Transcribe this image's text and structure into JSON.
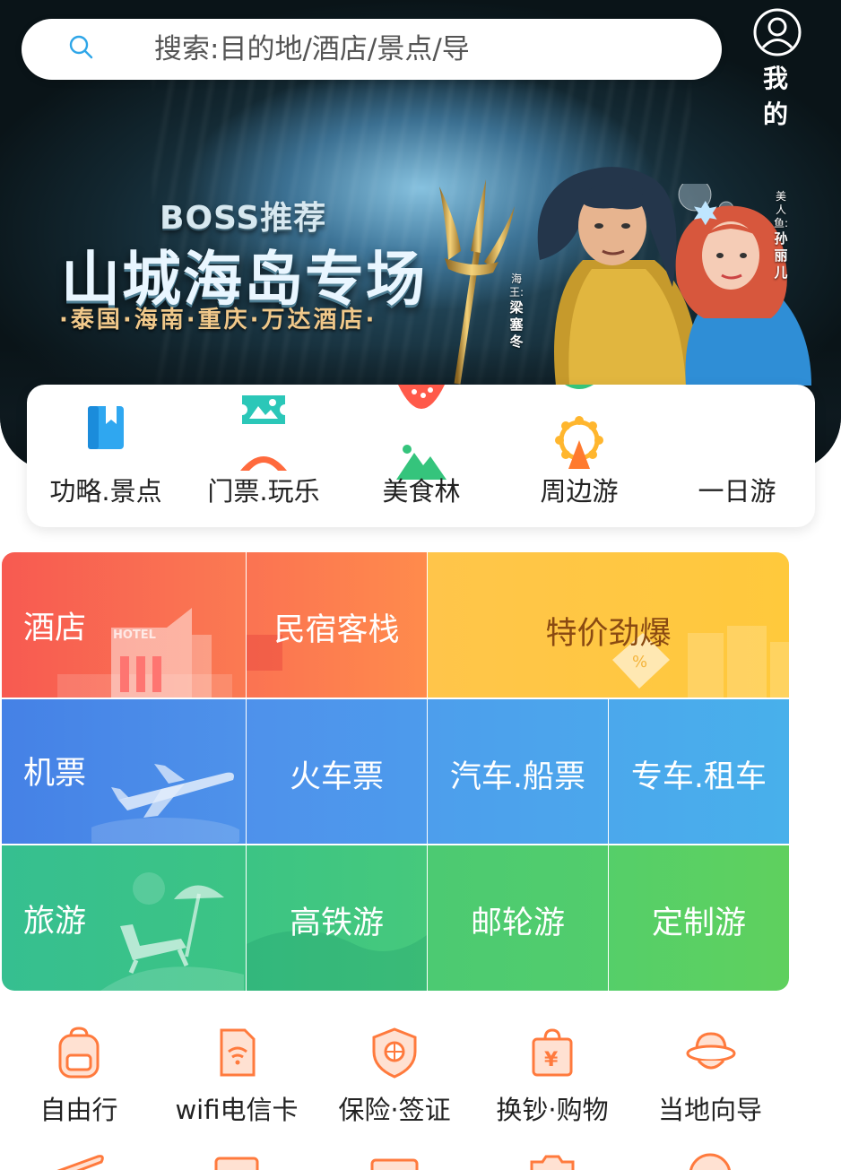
{
  "search": {
    "placeholder": "搜索:目的地/酒店/景点/导"
  },
  "profile": {
    "label": "我 的"
  },
  "banner": {
    "boss": "BOSS推荐",
    "headline": "山城海岛专场",
    "subline": "·泰国·海南·重庆·万达酒店·",
    "king_label": "海王:",
    "king_name": "梁塞冬",
    "mermaid_label": "美人鱼:",
    "mermaid_name": "孙丽儿"
  },
  "categories": [
    {
      "label": "功略.景点",
      "icon": "guide-book-icon"
    },
    {
      "label": "门票.玩乐",
      "icon": "ticket-icon"
    },
    {
      "label": "美食林",
      "icon": "food-icon"
    },
    {
      "label": "周边游",
      "icon": "ferris-wheel-icon"
    },
    {
      "label": "一日游",
      "icon": "day-trip-icon"
    }
  ],
  "tiles": {
    "hotel": "酒店",
    "hotel_sign": "HOTEL",
    "homestay": "民宿客栈",
    "deals": "特价劲爆",
    "flight": "机票",
    "train": "火车票",
    "bus_ship": "汽车.船票",
    "car_rental": "专车.租车",
    "travel": "旅游",
    "rail_tour": "高铁游",
    "cruise": "邮轮游",
    "custom": "定制游"
  },
  "services": [
    {
      "label": "自由行",
      "icon": "backpack-icon"
    },
    {
      "label": "wifi电信卡",
      "icon": "wifi-card-icon"
    },
    {
      "label": "保险·签证",
      "icon": "shield-icon"
    },
    {
      "label": "换钞·购物",
      "icon": "shopping-bag-icon"
    },
    {
      "label": "当地向导",
      "icon": "guide-hat-icon"
    }
  ],
  "colors": {
    "accent_orange": "#ff7a3d",
    "hotel_red": "#f75b50",
    "deals_yellow": "#ffc43d",
    "flight_blue": "#4a86ea",
    "travel_green": "#3cc48a"
  }
}
